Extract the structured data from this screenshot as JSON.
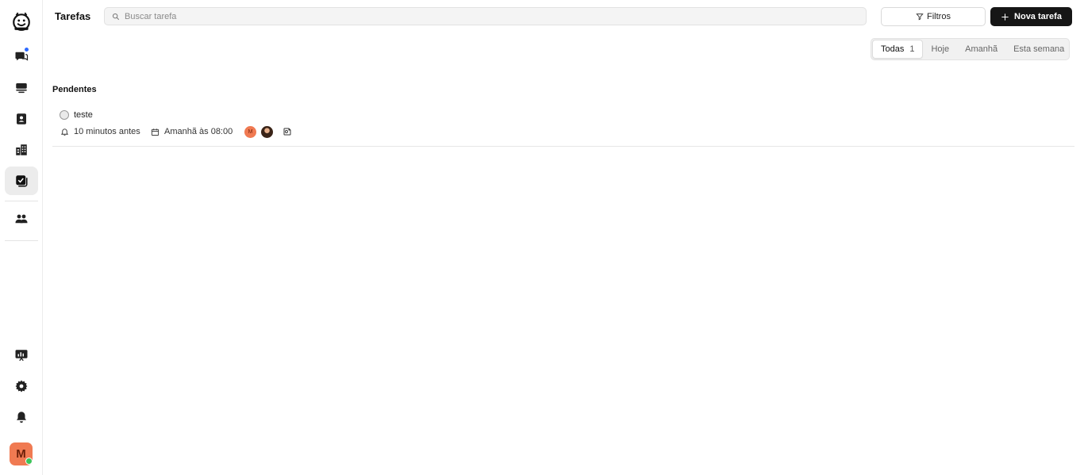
{
  "sidebar": {
    "items": [
      {
        "name": "chat-icon",
        "badge": true
      },
      {
        "name": "inbox-icon"
      },
      {
        "name": "contacts-icon"
      },
      {
        "name": "companies-icon"
      },
      {
        "name": "tasks-icon",
        "active": true
      },
      {
        "name": "team-icon"
      }
    ],
    "bottom": [
      {
        "name": "presentation-icon"
      },
      {
        "name": "gear-icon"
      },
      {
        "name": "bell-icon"
      }
    ],
    "user_initial": "M",
    "status_color": "#3bc45a",
    "avatar_color": "#f07a52"
  },
  "header": {
    "title": "Tarefas",
    "search_placeholder": "Buscar tarefa",
    "filter_label": "Filtros",
    "new_task_label": "Nova tarefa"
  },
  "tabs": [
    {
      "label": "Todas",
      "count": "1",
      "active": true
    },
    {
      "label": "Hoje"
    },
    {
      "label": "Amanhã"
    },
    {
      "label": "Esta semana"
    }
  ],
  "section": {
    "title": "Pendentes",
    "tasks": [
      {
        "title": "teste",
        "reminder": "10 minutos antes",
        "due": "Amanhã às 08:00",
        "assignee_initial": "M"
      }
    ]
  },
  "colors": {
    "accent_dark": "#161616",
    "notification_dot": "#2f6bff"
  }
}
